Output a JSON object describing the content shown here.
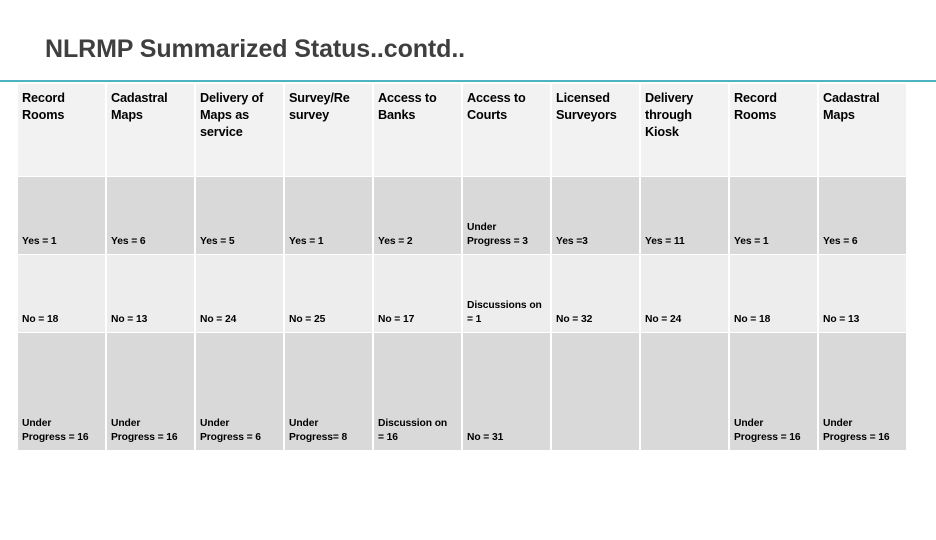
{
  "slide": {
    "title": "NLRMP Summarized Status..contd..",
    "accent_color": "#4cb2c4",
    "title_color": "#3f3f3f"
  },
  "table": {
    "headers": [
      "Record Rooms",
      "Cadastral Maps",
      "Delivery of Maps as service",
      "Survey/Re survey",
      "Access to Banks",
      "Access to Courts",
      "Licensed Surveyors",
      "Delivery through Kiosk",
      "Record Rooms",
      "Cadastral Maps"
    ],
    "row_colors": {
      "header": "#f2f2f2",
      "dark": "#d9d9d9",
      "light": "#ededed"
    },
    "rows": [
      {
        "label": "yes-row",
        "cells": [
          "Yes = 1",
          "Yes = 6",
          "Yes = 5",
          "Yes = 1",
          "Yes = 2",
          "Under\nProgress = 3",
          "Yes =3",
          "Yes = 11",
          "Yes = 1",
          "Yes = 6"
        ]
      },
      {
        "label": "no-row",
        "cells": [
          "No = 18",
          "No = 13",
          "No = 24",
          "No  = 25",
          "No = 17",
          "Discussions on\n= 1",
          "No = 32",
          "No = 24",
          "No = 18",
          "No = 13"
        ]
      },
      {
        "label": "under-progress-row",
        "cells": [
          "Under\nProgress = 16",
          "Under\nProgress = 16",
          "Under\nProgress = 6",
          "Under\nProgress= 8",
          "Discussion on\n= 16",
          "No = 31",
          "",
          "",
          "Under\nProgress = 16",
          "Under\nProgress = 16"
        ]
      }
    ]
  }
}
